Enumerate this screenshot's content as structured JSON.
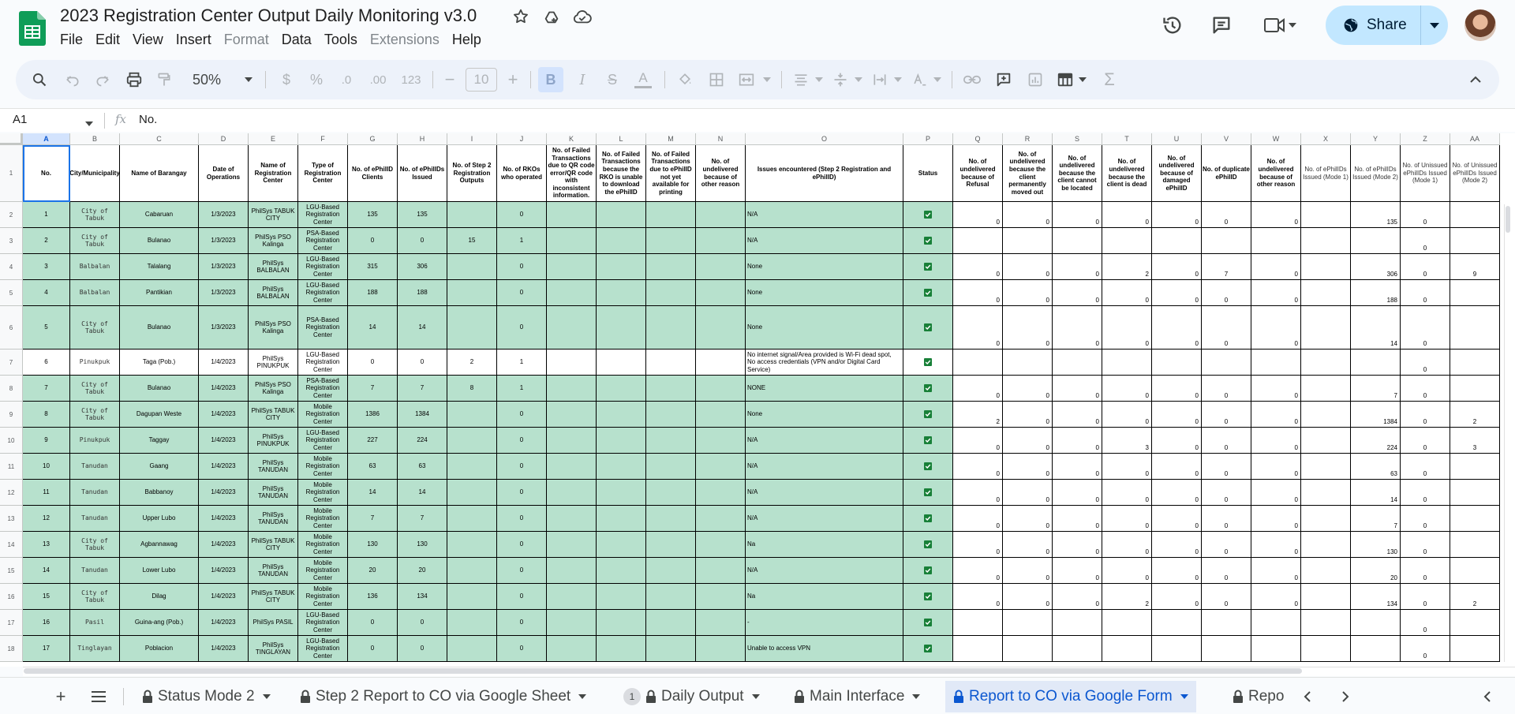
{
  "app": {
    "doc_title": "2023 Registration Center Output Daily Monitoring v3.0",
    "menus": [
      {
        "label": "File",
        "disabled": false
      },
      {
        "label": "Edit",
        "disabled": false
      },
      {
        "label": "View",
        "disabled": false
      },
      {
        "label": "Insert",
        "disabled": false
      },
      {
        "label": "Format",
        "disabled": true
      },
      {
        "label": "Data",
        "disabled": false
      },
      {
        "label": "Tools",
        "disabled": false
      },
      {
        "label": "Extensions",
        "disabled": true
      },
      {
        "label": "Help",
        "disabled": false
      }
    ],
    "share_label": "Share",
    "accent_color": "#c2e7ff",
    "sheets_green": "#0f9d58"
  },
  "toolbar": {
    "zoom": "50%",
    "currency": "$",
    "percent": "%",
    "dec_decrease": ".0",
    "dec_increase": ".00",
    "number_format": "123",
    "font_size": "10",
    "bold": "B",
    "italic": "I",
    "strike": "S",
    "text_color": "A"
  },
  "formula_bar": {
    "name_box": "A1",
    "fx": "fx",
    "value": "No."
  },
  "grid": {
    "column_letters": [
      "A",
      "B",
      "C",
      "D",
      "E",
      "F",
      "G",
      "H",
      "I",
      "J",
      "K",
      "L",
      "M",
      "N",
      "O",
      "P",
      "Q",
      "R",
      "S",
      "T",
      "U",
      "V",
      "W",
      "X",
      "Y",
      "Z",
      "AA"
    ],
    "headers": [
      "No.",
      "City/Municipality",
      "Name of Barangay",
      "Date of Operations",
      "Name of Registration Center",
      "Type of Registration Center",
      "No. of ePhilID Clients",
      "No. of ePhilIDs Issued",
      "No. of Step 2 Registration Outputs",
      "No. of RKOs who operated",
      "No. of Failed Transactions due to QR code error/QR code with inconsistent information.",
      "No. of Failed Transactions because the RKO is unable to download the ePhilID",
      "No. of Failed Transactions due to ePhilID not yet available for printing",
      "No. of undelivered because of other reason",
      "Issues encountered (Step 2 Registration and ePhilID)",
      "Status",
      "No. of undelivered because of Refusal",
      "No. of undelivered because the client permanently moved out",
      "No. of undelivered because the client cannot be located",
      "No. of undelivered because the client is dead",
      "No. of undelivered because of damaged ePhilID",
      "No. of duplicate ePhilID",
      "No. of undelivered because of other reason",
      "No. of ePhilIDs Issued (Mode 1)",
      "No. of ePhilIDs Issued (Mode 2)",
      "No. of Unissued ePhilIDs Issued (Mode 1)",
      "No. of Unissued ePhilIDs Issued (Mode 2)"
    ],
    "rows": [
      {
        "row": "2",
        "a": "1",
        "b": "City of Tabuk",
        "c": "Cabaruan",
        "d": "1/3/2023",
        "e": "PhilSys TABUK CITY",
        "f": "LGU-Based Registration Center",
        "g": "135",
        "h": "135",
        "i": "",
        "j": "0",
        "o": "N/A",
        "q": "0",
        "r": "0",
        "s": "0",
        "t": "0",
        "u": "0",
        "v": "0",
        "w": "0",
        "x": "",
        "y": "135",
        "z": "0",
        "aa": "",
        "bc": "g"
      },
      {
        "row": "3",
        "a": "2",
        "b": "City of Tabuk",
        "c": "Bulanao",
        "d": "1/3/2023",
        "e": "PhilSys PSO Kalinga",
        "f": "PSA-Based Registration Center",
        "g": "0",
        "h": "0",
        "i": "15",
        "j": "1",
        "o": "N/A",
        "q": "",
        "r": "",
        "s": "",
        "t": "",
        "u": "",
        "v": "",
        "w": "",
        "x": "",
        "y": "",
        "z": "0",
        "aa": "",
        "bc": "g"
      },
      {
        "row": "4",
        "a": "3",
        "b": "Balbalan",
        "c": "Talalang",
        "d": "1/3/2023",
        "e": "PhilSys BALBALAN",
        "f": "LGU-Based Registration Center",
        "g": "315",
        "h": "306",
        "i": "",
        "j": "0",
        "o": "None",
        "q": "0",
        "r": "0",
        "s": "0",
        "t": "2",
        "u": "0",
        "v": "7",
        "w": "0",
        "x": "",
        "y": "306",
        "z": "0",
        "aa": "9",
        "bc": "g"
      },
      {
        "row": "5",
        "a": "4",
        "b": "Balbalan",
        "c": "Pantikian",
        "d": "1/3/2023",
        "e": "PhilSys BALBALAN",
        "f": "LGU-Based Registration Center",
        "g": "188",
        "h": "188",
        "i": "",
        "j": "0",
        "o": "None",
        "q": "0",
        "r": "0",
        "s": "0",
        "t": "0",
        "u": "0",
        "v": "0",
        "w": "0",
        "x": "",
        "y": "188",
        "z": "0",
        "aa": "",
        "bc": "g"
      },
      {
        "row": "6",
        "a": "5",
        "b": "City of Tabuk",
        "c": "Bulanao",
        "d": "1/3/2023",
        "e": "PhilSys PSO Kalinga",
        "f": "PSA-Based Registration Center",
        "g": "14",
        "h": "14",
        "i": "",
        "j": "0",
        "o": "None",
        "q": "0",
        "r": "0",
        "s": "0",
        "t": "0",
        "u": "0",
        "v": "0",
        "w": "0",
        "x": "",
        "y": "14",
        "z": "0",
        "aa": "",
        "bc": "g"
      },
      {
        "row": "7",
        "a": "6",
        "b": "Pinukpuk",
        "c": "Taga (Pob.)",
        "d": "1/4/2023",
        "e": "PhilSys PINUKPUK",
        "f": "LGU-Based Registration Center",
        "g": "0",
        "h": "0",
        "i": "2",
        "j": "1",
        "o": "No internet signal/Area provided is Wi-Fi dead spot, No access credentials (VPN and/or Digital Card Service)",
        "q": "",
        "r": "",
        "s": "",
        "t": "",
        "u": "",
        "v": "",
        "w": "",
        "x": "",
        "y": "",
        "z": "0",
        "aa": "",
        "bc": "w"
      },
      {
        "row": "8",
        "a": "7",
        "b": "City of Tabuk",
        "c": "Bulanao",
        "d": "1/4/2023",
        "e": "PhilSys PSO Kalinga",
        "f": "PSA-Based Registration Center",
        "g": "7",
        "h": "7",
        "i": "8",
        "j": "1",
        "o": "NONE",
        "q": "0",
        "r": "0",
        "s": "0",
        "t": "0",
        "u": "0",
        "v": "0",
        "w": "0",
        "x": "",
        "y": "7",
        "z": "0",
        "aa": "",
        "bc": "g"
      },
      {
        "row": "9",
        "a": "8",
        "b": "City of Tabuk",
        "c": "Dagupan Weste",
        "d": "1/4/2023",
        "e": "PhilSys TABUK CITY",
        "f": "Mobile Registration Center",
        "g": "1386",
        "h": "1384",
        "i": "",
        "j": "0",
        "o": "None",
        "q": "2",
        "r": "0",
        "s": "0",
        "t": "0",
        "u": "0",
        "v": "0",
        "w": "0",
        "x": "",
        "y": "1384",
        "z": "0",
        "aa": "2",
        "bc": "g"
      },
      {
        "row": "10",
        "a": "9",
        "b": "Pinukpuk",
        "c": "Taggay",
        "d": "1/4/2023",
        "e": "PhilSys PINUKPUK",
        "f": "LGU-Based Registration Center",
        "g": "227",
        "h": "224",
        "i": "",
        "j": "0",
        "o": "N/A",
        "q": "0",
        "r": "0",
        "s": "0",
        "t": "3",
        "u": "0",
        "v": "0",
        "w": "0",
        "x": "",
        "y": "224",
        "z": "0",
        "aa": "3",
        "bc": "g"
      },
      {
        "row": "11",
        "a": "10",
        "b": "Tanudan",
        "c": "Gaang",
        "d": "1/4/2023",
        "e": "PhilSys TANUDAN",
        "f": "Mobile Registration Center",
        "g": "63",
        "h": "63",
        "i": "",
        "j": "0",
        "o": "N/A",
        "q": "0",
        "r": "0",
        "s": "0",
        "t": "0",
        "u": "0",
        "v": "0",
        "w": "0",
        "x": "",
        "y": "63",
        "z": "0",
        "aa": "",
        "bc": "g"
      },
      {
        "row": "12",
        "a": "11",
        "b": "Tanudan",
        "c": "Babbanoy",
        "d": "1/4/2023",
        "e": "PhilSys TANUDAN",
        "f": "Mobile Registration Center",
        "g": "14",
        "h": "14",
        "i": "",
        "j": "0",
        "o": "N/A",
        "q": "0",
        "r": "0",
        "s": "0",
        "t": "0",
        "u": "0",
        "v": "0",
        "w": "0",
        "x": "",
        "y": "14",
        "z": "0",
        "aa": "",
        "bc": "g"
      },
      {
        "row": "13",
        "a": "12",
        "b": "Tanudan",
        "c": "Upper Lubo",
        "d": "1/4/2023",
        "e": "PhilSys TANUDAN",
        "f": "Mobile Registration Center",
        "g": "7",
        "h": "7",
        "i": "",
        "j": "0",
        "o": "N/A",
        "q": "0",
        "r": "0",
        "s": "0",
        "t": "0",
        "u": "0",
        "v": "0",
        "w": "0",
        "x": "",
        "y": "7",
        "z": "0",
        "aa": "",
        "bc": "g"
      },
      {
        "row": "14",
        "a": "13",
        "b": "City of Tabuk",
        "c": "Agbannawag",
        "d": "1/4/2023",
        "e": "PhilSys TABUK CITY",
        "f": "Mobile Registration Center",
        "g": "130",
        "h": "130",
        "i": "",
        "j": "0",
        "o": "Na",
        "q": "0",
        "r": "0",
        "s": "0",
        "t": "0",
        "u": "0",
        "v": "0",
        "w": "0",
        "x": "",
        "y": "130",
        "z": "0",
        "aa": "",
        "bc": "g"
      },
      {
        "row": "15",
        "a": "14",
        "b": "Tanudan",
        "c": "Lower Lubo",
        "d": "1/4/2023",
        "e": "PhilSys TANUDAN",
        "f": "Mobile Registration Center",
        "g": "20",
        "h": "20",
        "i": "",
        "j": "0",
        "o": "N/A",
        "q": "0",
        "r": "0",
        "s": "0",
        "t": "0",
        "u": "0",
        "v": "0",
        "w": "0",
        "x": "",
        "y": "20",
        "z": "0",
        "aa": "",
        "bc": "g"
      },
      {
        "row": "16",
        "a": "15",
        "b": "City of Tabuk",
        "c": "Dilag",
        "d": "1/4/2023",
        "e": "PhilSys TABUK CITY",
        "f": "Mobile Registration Center",
        "g": "136",
        "h": "134",
        "i": "",
        "j": "0",
        "o": "Na",
        "q": "0",
        "r": "0",
        "s": "0",
        "t": "2",
        "u": "0",
        "v": "0",
        "w": "0",
        "x": "",
        "y": "134",
        "z": "0",
        "aa": "2",
        "bc": "g"
      },
      {
        "row": "17",
        "a": "16",
        "b": "Pasil",
        "c": "Guina-ang (Pob.)",
        "d": "1/4/2023",
        "e": "PhilSys PASIL",
        "f": "LGU-Based Registration Center",
        "g": "0",
        "h": "0",
        "i": "",
        "j": "0",
        "o": "-",
        "q": "",
        "r": "",
        "s": "",
        "t": "",
        "u": "",
        "v": "",
        "w": "",
        "x": "",
        "y": "",
        "z": "0",
        "aa": "",
        "bc": "g"
      },
      {
        "row": "18",
        "a": "17",
        "b": "Tinglayan",
        "c": "Poblacion",
        "d": "1/4/2023",
        "e": "PhilSys TINGLAYAN",
        "f": "LGU-Based Registration Center",
        "g": "0",
        "h": "0",
        "i": "",
        "j": "0",
        "o": "Unable to access VPN",
        "q": "",
        "r": "",
        "s": "",
        "t": "",
        "u": "",
        "v": "",
        "w": "",
        "x": "",
        "y": "",
        "z": "0",
        "aa": "",
        "bc": "g"
      }
    ],
    "row_fill_color": "#b7e1cd"
  },
  "sheet_tabs": [
    {
      "label": "Status Mode 2",
      "locked": true,
      "badge": "",
      "active": false
    },
    {
      "label": "Step 2 Report to CO via Google Sheet",
      "locked": true,
      "badge": "",
      "active": false
    },
    {
      "label": "Daily Output",
      "locked": true,
      "badge": "1",
      "active": false
    },
    {
      "label": "Main Interface",
      "locked": true,
      "badge": "",
      "active": false
    },
    {
      "label": "Report to CO via Google Form",
      "locked": true,
      "badge": "",
      "active": true
    },
    {
      "label": "Repo",
      "locked": true,
      "badge": "",
      "active": false
    }
  ]
}
